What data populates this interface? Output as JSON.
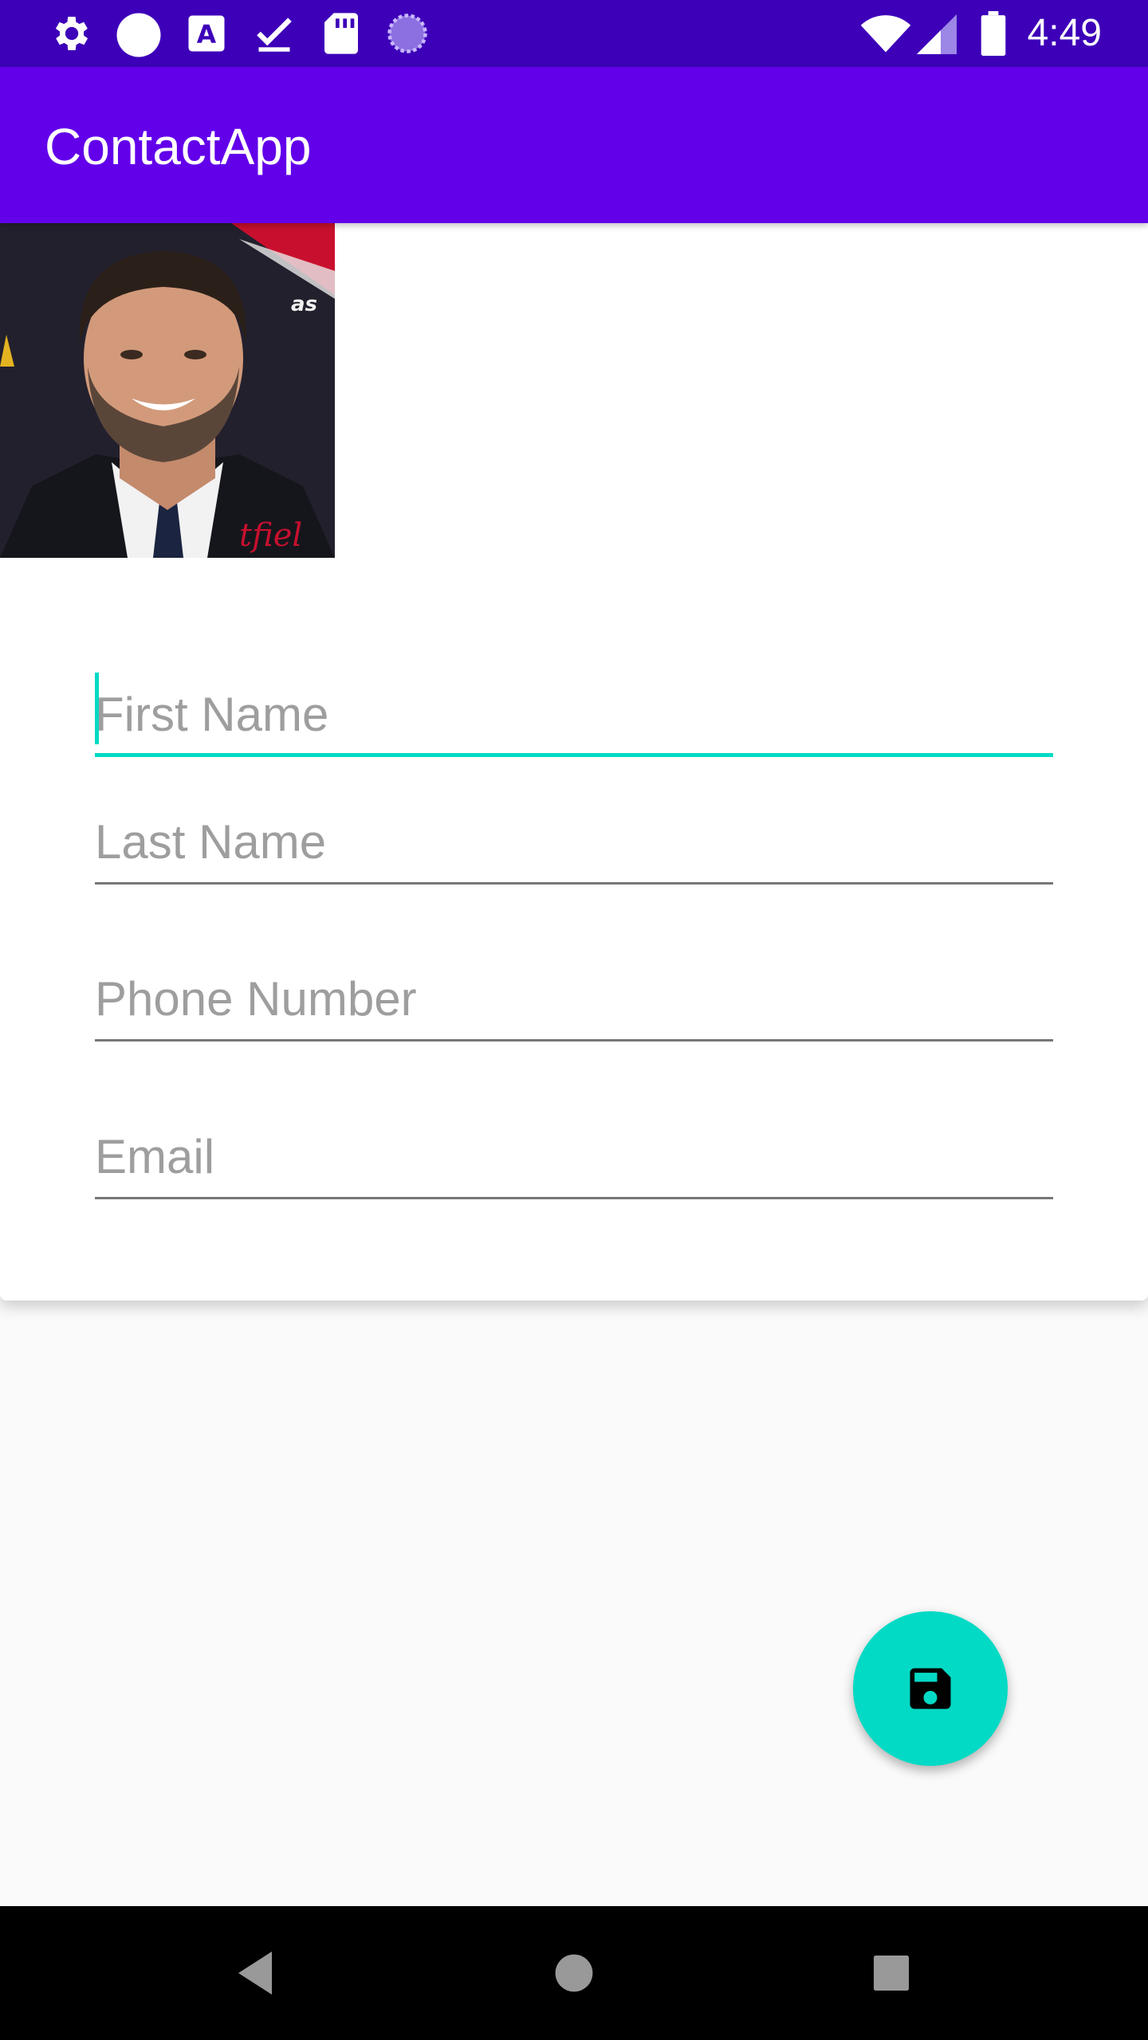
{
  "status_bar": {
    "time": "4:49",
    "left_icons": [
      "gear-icon",
      "circle-icon",
      "a-notification-icon",
      "check-icon",
      "sd-card-icon",
      "loading-icon"
    ],
    "right_icons": [
      "wifi-icon",
      "signal-icon",
      "battery-icon"
    ],
    "color": "#3d00b8"
  },
  "app_bar": {
    "title": "ContactApp",
    "color": "#6200ea"
  },
  "form": {
    "first_name": {
      "placeholder": "First Name",
      "value": ""
    },
    "last_name": {
      "placeholder": "Last Name",
      "value": ""
    },
    "phone": {
      "placeholder": "Phone Number",
      "value": ""
    },
    "email": {
      "placeholder": "Email",
      "value": ""
    }
  },
  "fab": {
    "icon": "save-icon",
    "color": "#03dac5"
  },
  "nav_bar": {
    "icons": [
      "back-icon",
      "home-icon",
      "recents-icon"
    ]
  },
  "accent_color": "#03dac5"
}
